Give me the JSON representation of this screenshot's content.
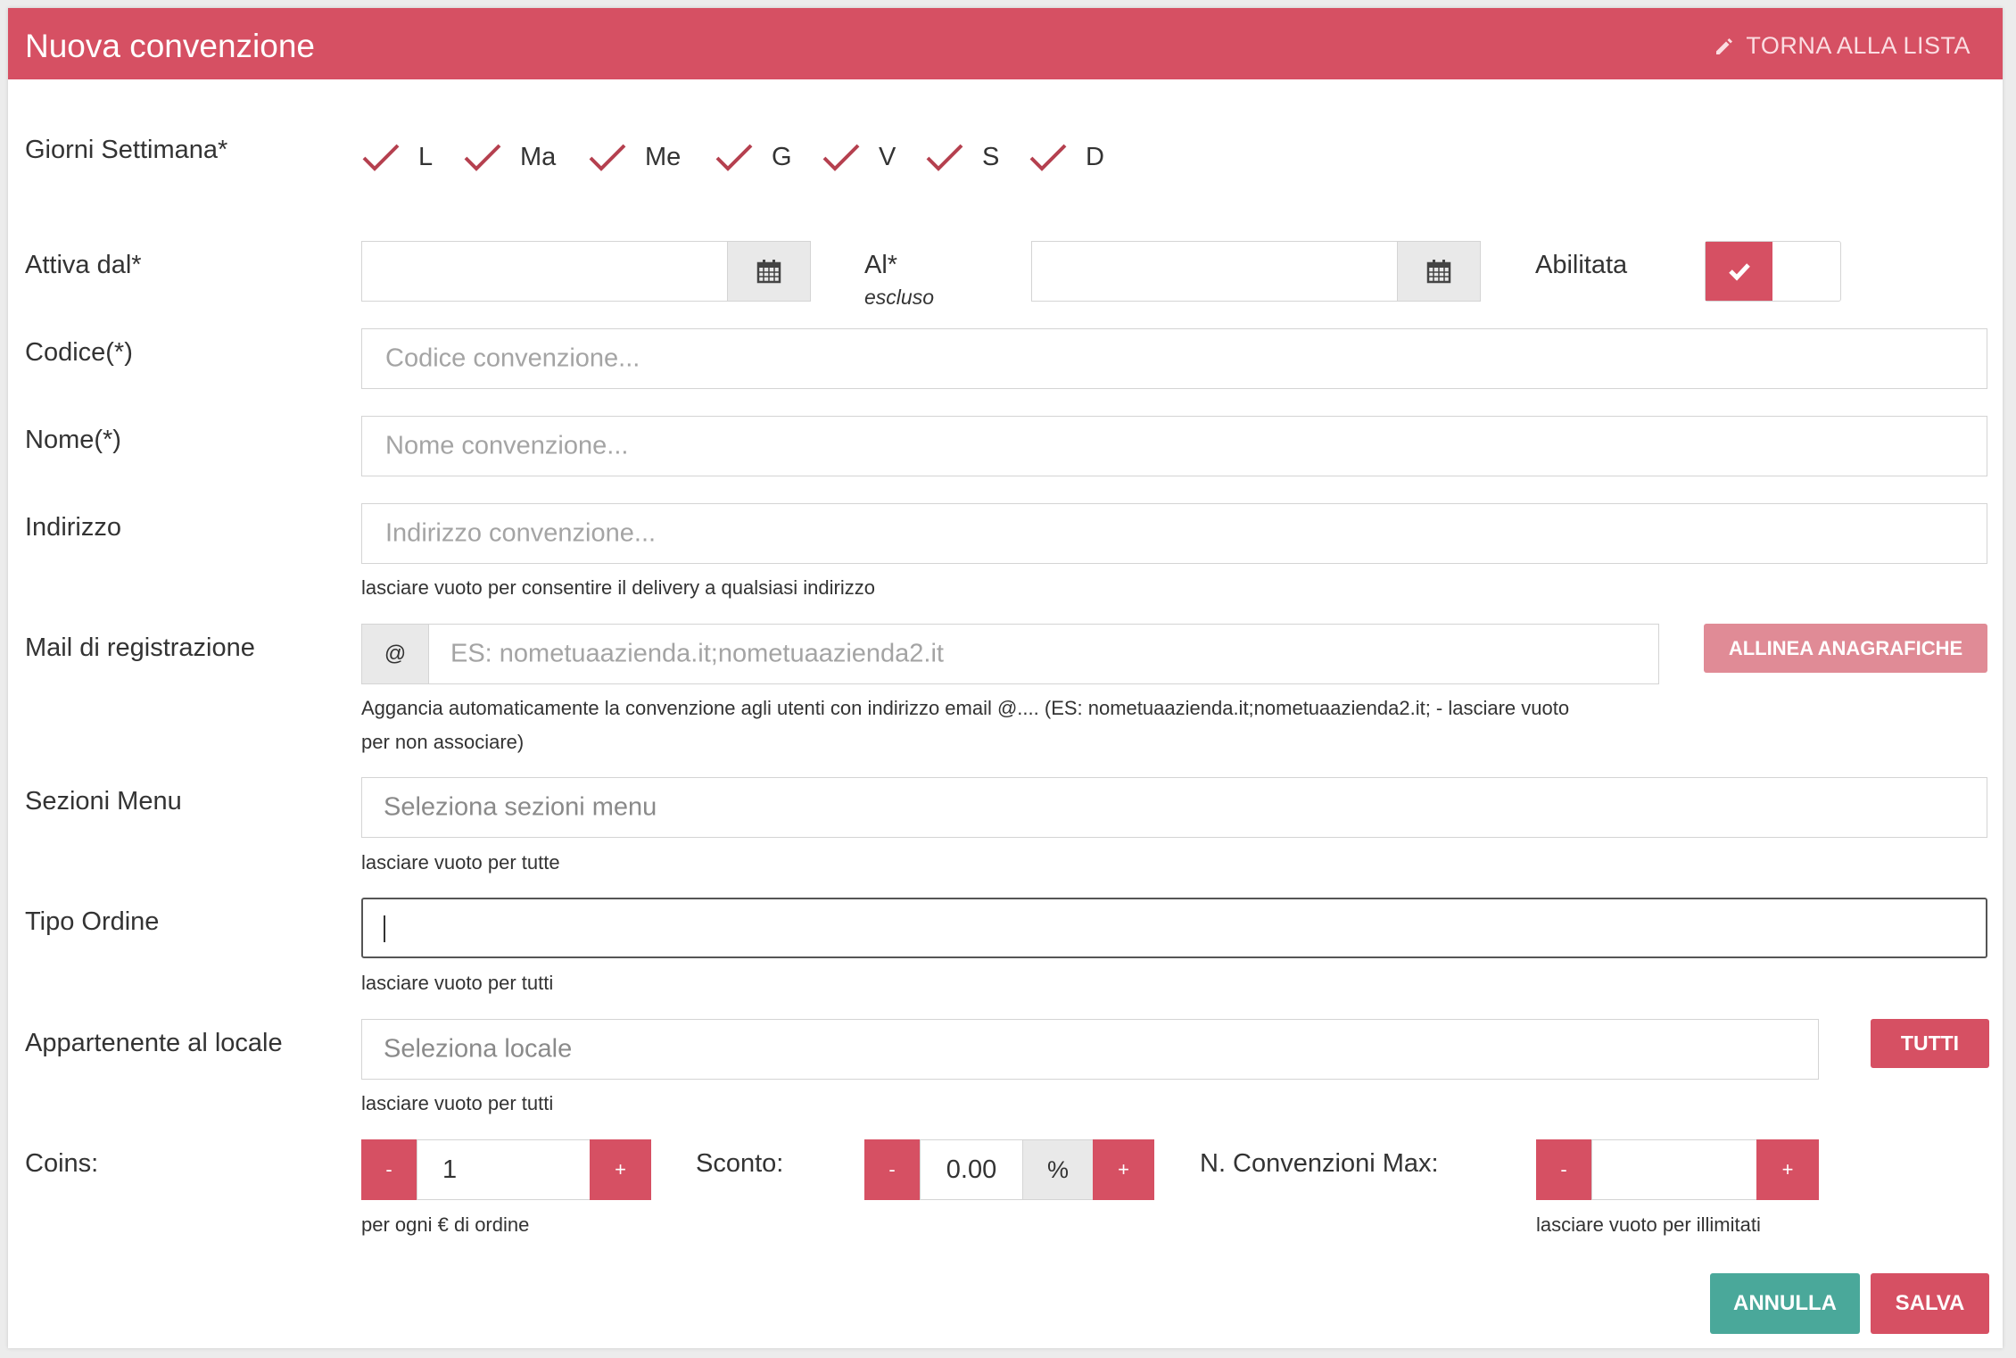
{
  "header": {
    "title": "Nuova convenzione",
    "back_label": "TORNA ALLA LISTA"
  },
  "days": {
    "label": "Giorni Settimana*",
    "items": [
      {
        "label": "L",
        "checked": true
      },
      {
        "label": "Ma",
        "checked": true
      },
      {
        "label": "Me",
        "checked": true
      },
      {
        "label": "G",
        "checked": true
      },
      {
        "label": "V",
        "checked": true
      },
      {
        "label": "S",
        "checked": true
      },
      {
        "label": "D",
        "checked": true
      }
    ]
  },
  "active_from": {
    "label": "Attiva dal*",
    "value": ""
  },
  "active_to": {
    "label": "Al*",
    "sublabel": "escluso",
    "value": ""
  },
  "enabled": {
    "label": "Abilitata",
    "value": true
  },
  "code": {
    "label": "Codice(*)",
    "placeholder": "Codice convenzione..."
  },
  "name": {
    "label": "Nome(*)",
    "placeholder": "Nome convenzione..."
  },
  "address": {
    "label": "Indirizzo",
    "placeholder": "Indirizzo convenzione...",
    "help": "lasciare vuoto per consentire il delivery a qualsiasi indirizzo"
  },
  "mail": {
    "label": "Mail di registrazione",
    "addon": "@",
    "placeholder": "ES: nometuaazienda.it;nometuaazienda2.it",
    "help_line1": "Aggancia automaticamente la convenzione agli utenti con indirizzo email @.... (ES: nometuaazienda.it;nometuaazienda2.it; - lasciare vuoto",
    "help_line2": "per non associare)",
    "align_button": "ALLINEA ANAGRAFICHE"
  },
  "menu_sections": {
    "label": "Sezioni Menu",
    "placeholder": "Seleziona sezioni menu",
    "help": "lasciare vuoto per tutte"
  },
  "order_type": {
    "label": "Tipo Ordine",
    "value": "",
    "help": "lasciare vuoto per tutti"
  },
  "local": {
    "label": "Appartenente al locale",
    "placeholder": "Seleziona locale",
    "help": "lasciare vuoto per tutti",
    "all_button": "TUTTI"
  },
  "coins": {
    "label": "Coins:",
    "value": "1",
    "help": "per ogni € di ordine",
    "minus": "-",
    "plus": "+"
  },
  "discount": {
    "label": "Sconto:",
    "value": "0.00",
    "unit": "%",
    "minus": "-",
    "plus": "+"
  },
  "max_conv": {
    "label": "N. Convenzioni Max:",
    "value": "",
    "help": "lasciare vuoto per illimitati",
    "minus": "-",
    "plus": "+"
  },
  "footer": {
    "cancel": "ANNULLA",
    "save": "SALVA"
  },
  "colors": {
    "accent": "#d65063",
    "accent_light": "#e08b96",
    "teal": "#4aa89a",
    "check": "#b5404f"
  }
}
